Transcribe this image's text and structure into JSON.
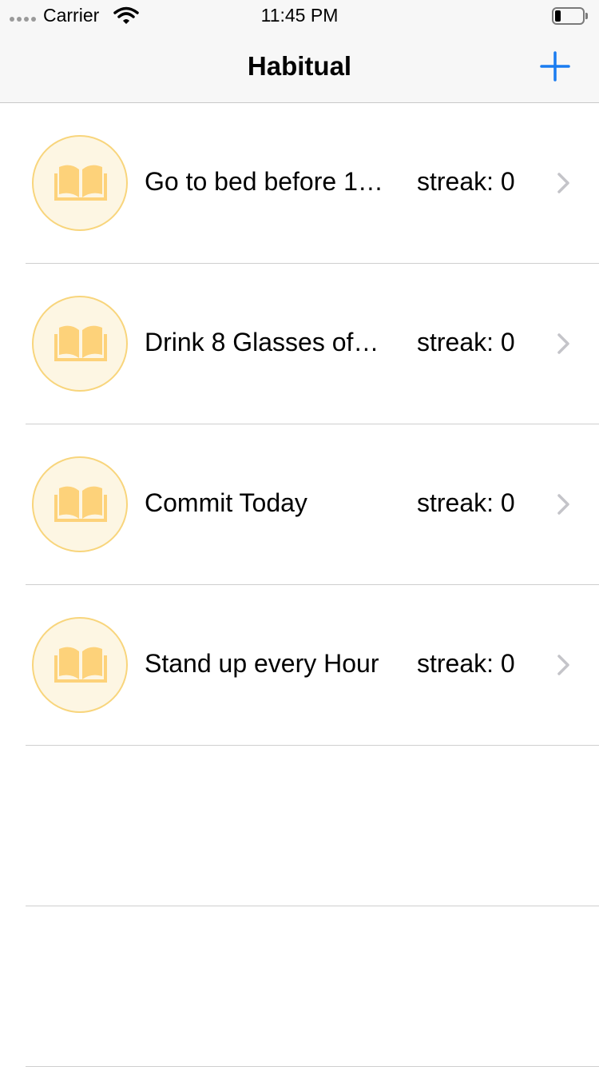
{
  "status_bar": {
    "carrier": "Carrier",
    "time": "11:45 PM"
  },
  "nav": {
    "title": "Habitual",
    "add_icon": "plus-icon",
    "accent_color": "#1a7cf0"
  },
  "habits": [
    {
      "name": "Go to bed before 1…",
      "streak": "streak: 0",
      "icon": "book-icon"
    },
    {
      "name": "Drink 8 Glasses of…",
      "streak": "streak: 0",
      "icon": "book-icon"
    },
    {
      "name": "Commit Today",
      "streak": "streak: 0",
      "icon": "book-icon"
    },
    {
      "name": "Stand up every Hour",
      "streak": "streak: 0",
      "icon": "book-icon"
    }
  ],
  "colors": {
    "icon_fill": "#fdd27a",
    "icon_border": "#f8d57c",
    "icon_bg": "#fdf6e3",
    "chevron": "#c4c4c9"
  }
}
